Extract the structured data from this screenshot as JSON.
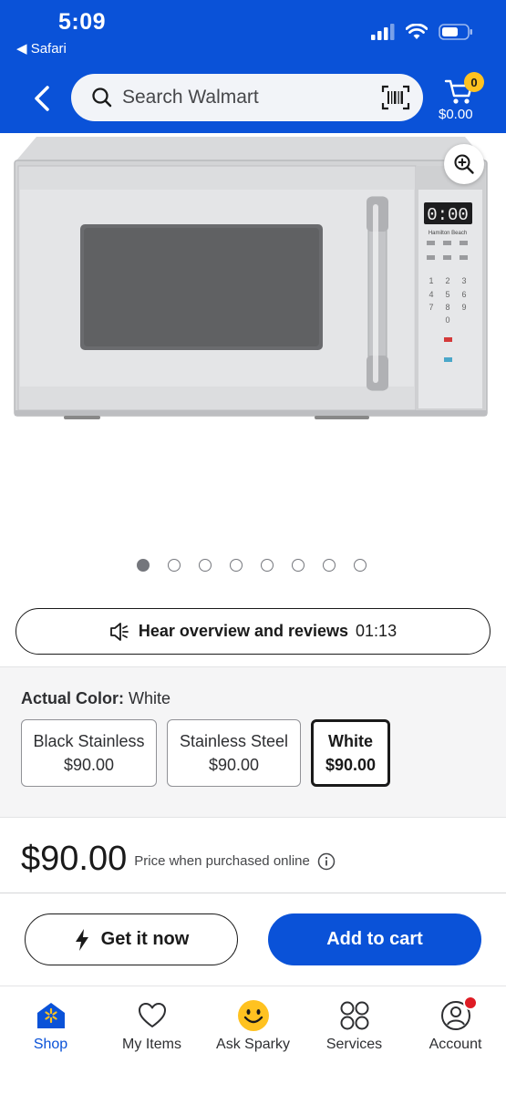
{
  "status_bar": {
    "time": "5:09",
    "back_app": "◀ Safari"
  },
  "header": {
    "search_placeholder": "Search Walmart",
    "cart_count": "0",
    "cart_total": "$0.00"
  },
  "product_image": {
    "display_time": "0:00",
    "brand_mark": "Hamilton Beach",
    "carousel_total": 8,
    "carousel_active": 1
  },
  "audio": {
    "label": "Hear overview and reviews",
    "duration": "01:13"
  },
  "variants": {
    "label_key": "Actual Color:",
    "label_value": "White",
    "options": [
      {
        "name": "Black Stainless",
        "price": "$90.00"
      },
      {
        "name": "Stainless Steel",
        "price": "$90.00"
      },
      {
        "name": "White",
        "price": "$90.00"
      }
    ],
    "selected_index": 2
  },
  "price": {
    "amount": "$90.00",
    "note": "Price when purchased online"
  },
  "actions": {
    "get_now": "Get it now",
    "add_to_cart": "Add to cart"
  },
  "tabs": [
    {
      "label": "Shop",
      "icon": "spark-home-icon"
    },
    {
      "label": "My Items",
      "icon": "heart-icon"
    },
    {
      "label": "Ask Sparky",
      "icon": "smiley-icon"
    },
    {
      "label": "Services",
      "icon": "grid-circles-icon"
    },
    {
      "label": "Account",
      "icon": "person-icon"
    }
  ],
  "colors": {
    "brand_blue": "#0a52d8",
    "badge_yellow": "#ffc220",
    "notification_red": "#de1c24"
  }
}
